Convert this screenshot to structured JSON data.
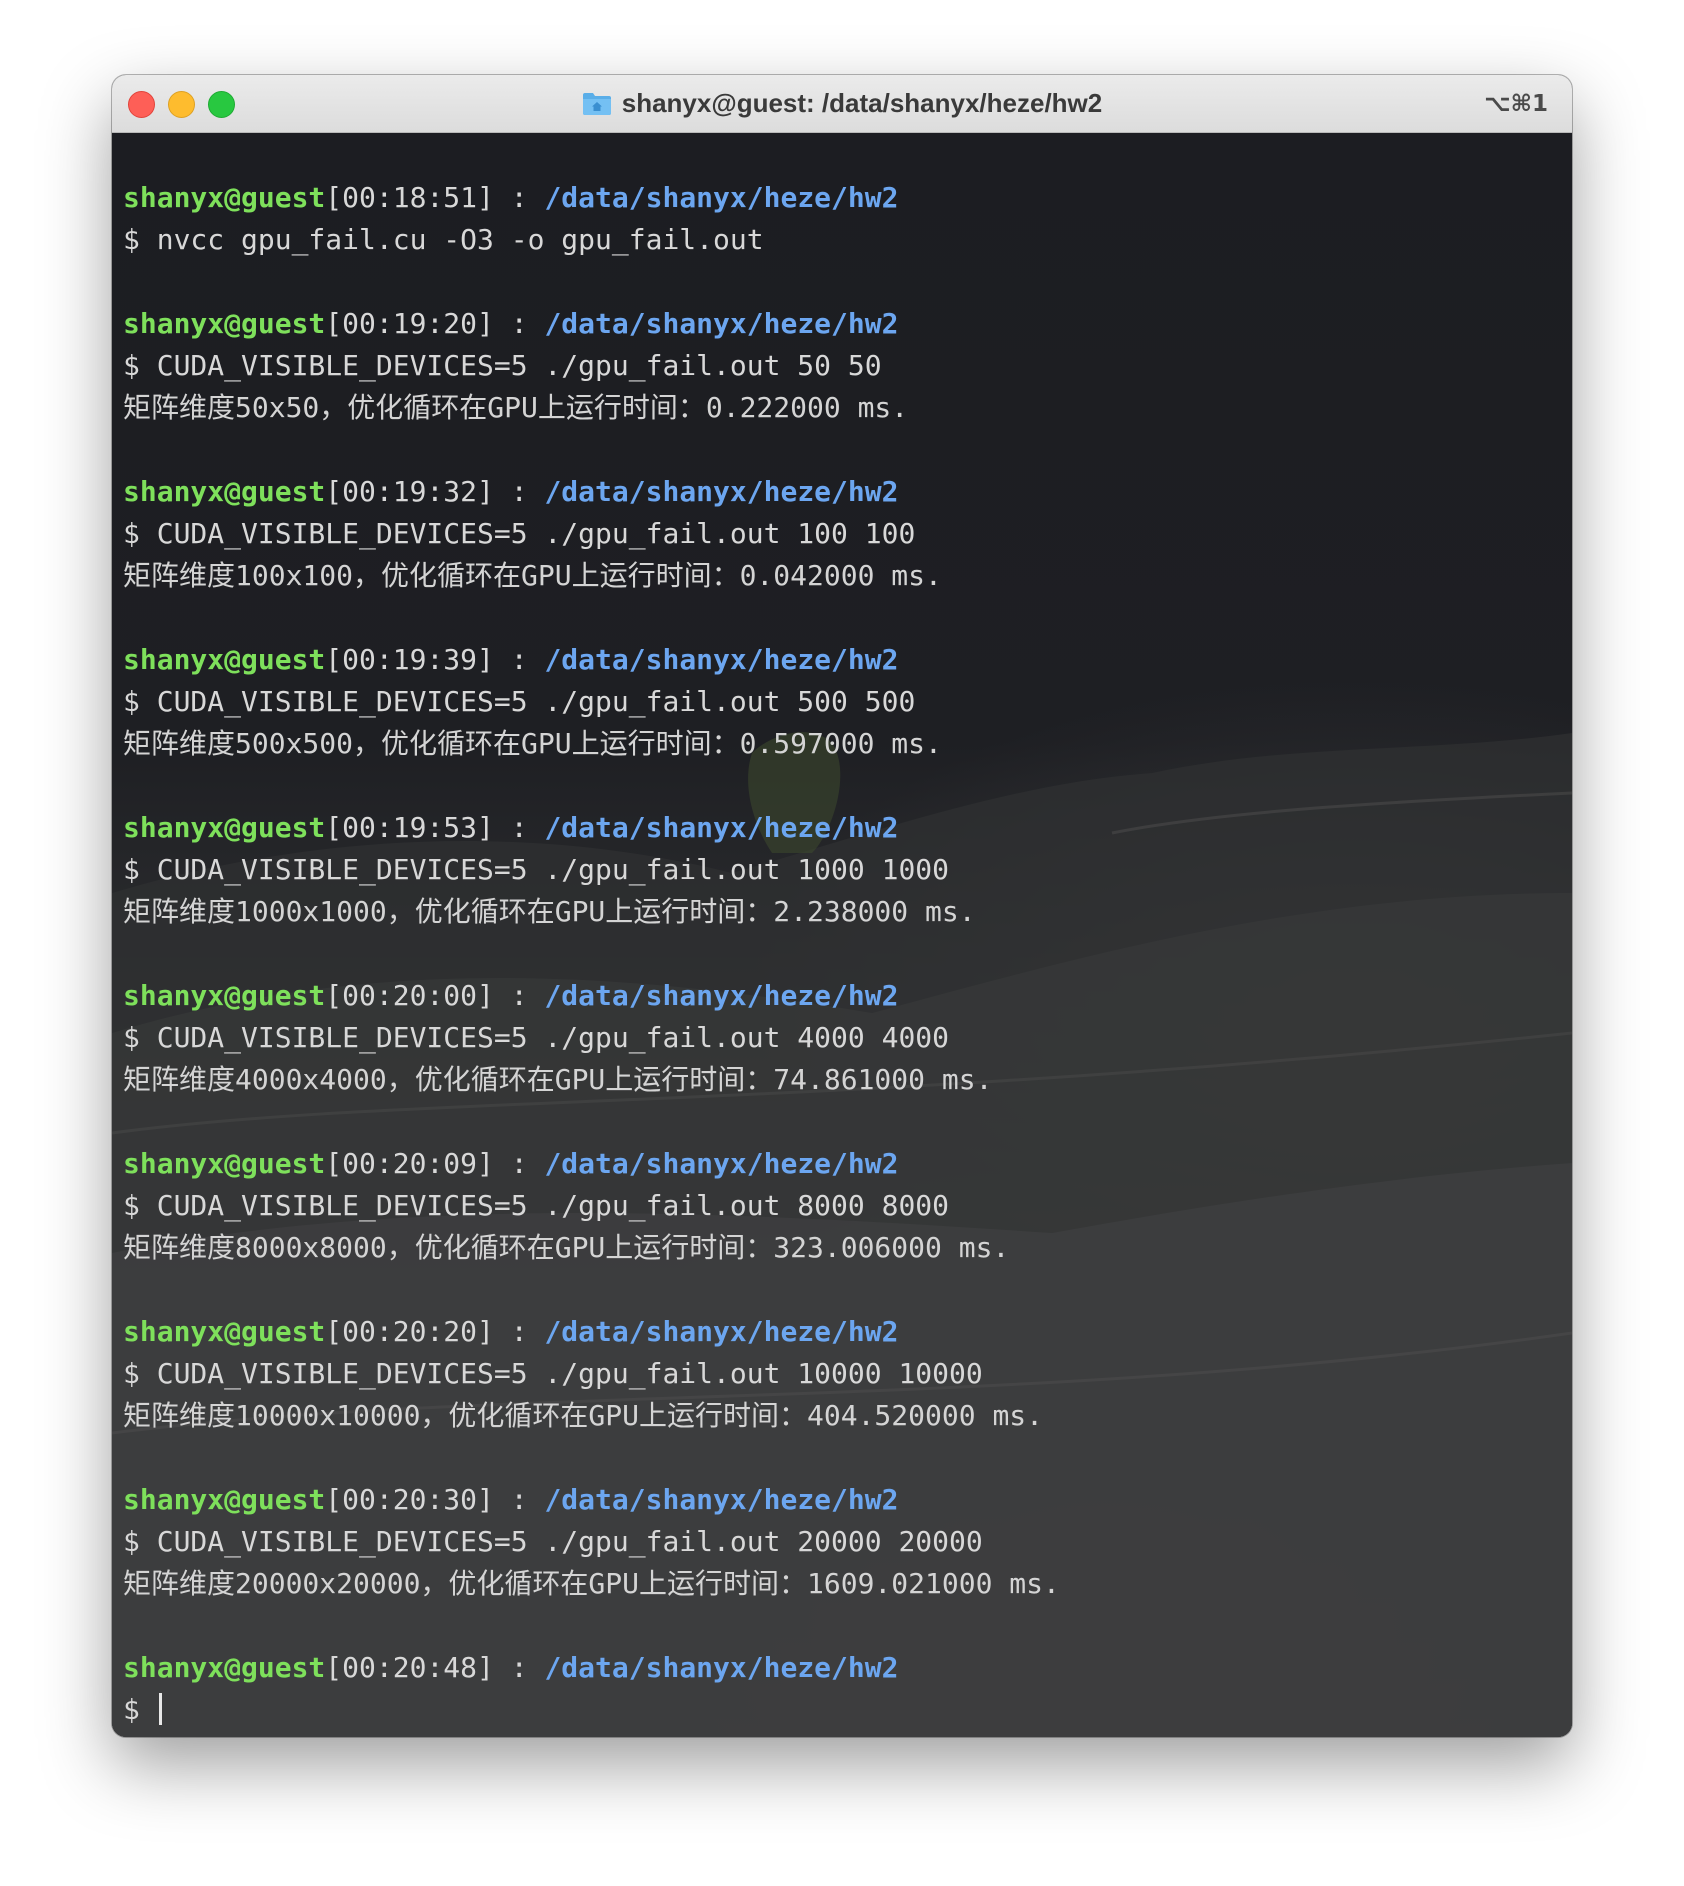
{
  "window": {
    "title": "shanyx@guest: /data/shanyx/heze/hw2",
    "shortcut": "⌥⌘1",
    "title_icon": "home-folder-icon"
  },
  "colors": {
    "prompt_user": "#7ee05b",
    "prompt_path": "#6ca6f0",
    "text": "#d8d8d8"
  },
  "session": [
    {
      "user": "shanyx@guest",
      "time": "[00:18:51]",
      "sep": " : ",
      "path": "/data/shanyx/heze/hw2",
      "command": "$ nvcc gpu_fail.cu -O3 -o gpu_fail.out",
      "output": ""
    },
    {
      "user": "shanyx@guest",
      "time": "[00:19:20]",
      "sep": " : ",
      "path": "/data/shanyx/heze/hw2",
      "command": "$ CUDA_VISIBLE_DEVICES=5 ./gpu_fail.out 50 50",
      "output": "矩阵维度50x50，优化循环在GPU上运行时间：0.222000 ms."
    },
    {
      "user": "shanyx@guest",
      "time": "[00:19:32]",
      "sep": " : ",
      "path": "/data/shanyx/heze/hw2",
      "command": "$ CUDA_VISIBLE_DEVICES=5 ./gpu_fail.out 100 100",
      "output": "矩阵维度100x100，优化循环在GPU上运行时间：0.042000 ms."
    },
    {
      "user": "shanyx@guest",
      "time": "[00:19:39]",
      "sep": " : ",
      "path": "/data/shanyx/heze/hw2",
      "command": "$ CUDA_VISIBLE_DEVICES=5 ./gpu_fail.out 500 500",
      "output": "矩阵维度500x500，优化循环在GPU上运行时间：0.597000 ms."
    },
    {
      "user": "shanyx@guest",
      "time": "[00:19:53]",
      "sep": " : ",
      "path": "/data/shanyx/heze/hw2",
      "command": "$ CUDA_VISIBLE_DEVICES=5 ./gpu_fail.out 1000 1000",
      "output": "矩阵维度1000x1000，优化循环在GPU上运行时间：2.238000 ms."
    },
    {
      "user": "shanyx@guest",
      "time": "[00:20:00]",
      "sep": " : ",
      "path": "/data/shanyx/heze/hw2",
      "command": "$ CUDA_VISIBLE_DEVICES=5 ./gpu_fail.out 4000 4000",
      "output": "矩阵维度4000x4000，优化循环在GPU上运行时间：74.861000 ms."
    },
    {
      "user": "shanyx@guest",
      "time": "[00:20:09]",
      "sep": " : ",
      "path": "/data/shanyx/heze/hw2",
      "command": "$ CUDA_VISIBLE_DEVICES=5 ./gpu_fail.out 8000 8000",
      "output": "矩阵维度8000x8000，优化循环在GPU上运行时间：323.006000 ms."
    },
    {
      "user": "shanyx@guest",
      "time": "[00:20:20]",
      "sep": " : ",
      "path": "/data/shanyx/heze/hw2",
      "command": "$ CUDA_VISIBLE_DEVICES=5 ./gpu_fail.out 10000 10000",
      "output": "矩阵维度10000x10000，优化循环在GPU上运行时间：404.520000 ms."
    },
    {
      "user": "shanyx@guest",
      "time": "[00:20:30]",
      "sep": " : ",
      "path": "/data/shanyx/heze/hw2",
      "command": "$ CUDA_VISIBLE_DEVICES=5 ./gpu_fail.out 20000 20000",
      "output": "矩阵维度20000x20000，优化循环在GPU上运行时间：1609.021000 ms."
    }
  ],
  "current_prompt": {
    "user": "shanyx@guest",
    "time": "[00:20:48]",
    "sep": " : ",
    "path": "/data/shanyx/heze/hw2",
    "input": "$ "
  }
}
